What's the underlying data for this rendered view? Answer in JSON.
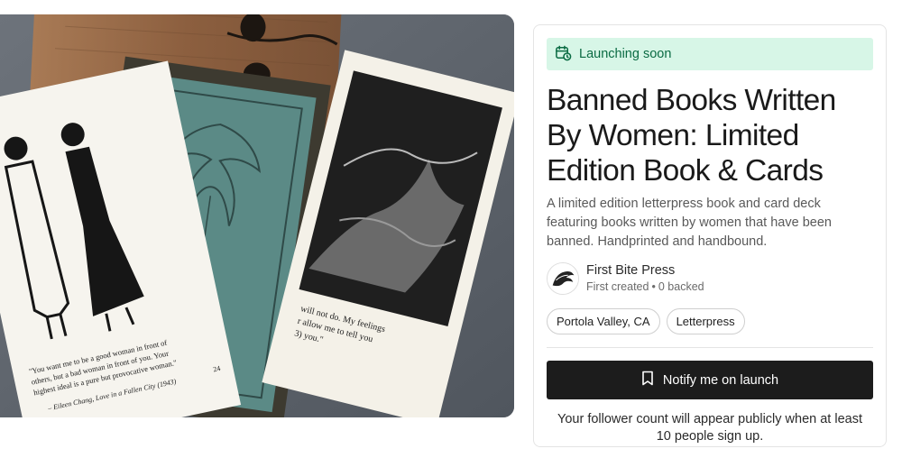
{
  "hero": {
    "card1_quote": [
      "\"You want me to be a good woman in front of",
      "others, but a bad woman in front of you. Your",
      "highest ideal is a pure but provocative woman.\""
    ],
    "card1_attribution": "– Eileen Chang, Love in a Fallen City (1943)",
    "card1_page": "24",
    "card3_quote": [
      "will not do. My feelings",
      "r allow me to tell you",
      "3) you.\""
    ]
  },
  "status": {
    "label": "Launching soon",
    "icon": "calendar-clock-icon",
    "accent": "#0a6b43",
    "background": "#d7f6e7"
  },
  "project": {
    "title": "Banned Books Written By Women: Limited Edition Book & Cards",
    "description": "A limited edition letterpress book and card deck featuring books written by women that have been banned. Handprinted and handbound."
  },
  "creator": {
    "name": "First Bite Press",
    "first_created": "First created",
    "separator": "•",
    "backed": "0 backed"
  },
  "tags": [
    "Portola Valley, CA",
    "Letterpress"
  ],
  "actions": {
    "notify_label": "Notify me on launch",
    "notify_icon": "bookmark-icon"
  },
  "footer_note": "Your follower count will appear publicly when at least 10 people sign up."
}
